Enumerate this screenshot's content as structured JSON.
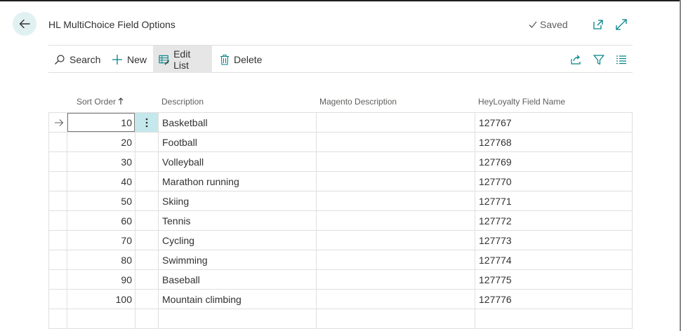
{
  "header": {
    "title": "HL MultiChoice Field Options",
    "saved_label": "Saved",
    "icons": [
      "back-arrow-icon",
      "checkmark-icon",
      "open-in-new-window-icon",
      "expand-icon"
    ]
  },
  "toolbar": {
    "search_label": "Search",
    "new_label": "New",
    "edit_list_label": "Edit List",
    "delete_label": "Delete",
    "right_icons": [
      "share-icon",
      "filter-icon",
      "list-view-icon"
    ]
  },
  "columns": {
    "sort_order": "Sort Order",
    "description": "Description",
    "magento_description": "Magento Description",
    "heyloyalty_field_name": "HeyLoyalty Field Name"
  },
  "rows": [
    {
      "sort_order": "10",
      "description": "Basketball",
      "magento_description": "",
      "heyloyalty_field_name": "127767"
    },
    {
      "sort_order": "20",
      "description": "Football",
      "magento_description": "",
      "heyloyalty_field_name": "127768"
    },
    {
      "sort_order": "30",
      "description": "Volleyball",
      "magento_description": "",
      "heyloyalty_field_name": "127769"
    },
    {
      "sort_order": "40",
      "description": "Marathon running",
      "magento_description": "",
      "heyloyalty_field_name": "127770"
    },
    {
      "sort_order": "50",
      "description": "Skiing",
      "magento_description": "",
      "heyloyalty_field_name": "127771"
    },
    {
      "sort_order": "60",
      "description": "Tennis",
      "magento_description": "",
      "heyloyalty_field_name": "127772"
    },
    {
      "sort_order": "70",
      "description": "Cycling",
      "magento_description": "",
      "heyloyalty_field_name": "127773"
    },
    {
      "sort_order": "80",
      "description": "Swimming",
      "magento_description": "",
      "heyloyalty_field_name": "127774"
    },
    {
      "sort_order": "90",
      "description": "Baseball",
      "magento_description": "",
      "heyloyalty_field_name": "127775"
    },
    {
      "sort_order": "100",
      "description": "Mountain climbing",
      "magento_description": "",
      "heyloyalty_field_name": "127776"
    },
    {
      "sort_order": "",
      "description": "",
      "magento_description": "",
      "heyloyalty_field_name": ""
    }
  ],
  "selected_row": 0,
  "colors": {
    "accent": "#008489",
    "back_button_bg": "#e1f1f2",
    "selected_cell_bg": "#c4e8ec",
    "active_button_bg": "#e6e6e6",
    "grid_line": "#e1dfdd"
  }
}
